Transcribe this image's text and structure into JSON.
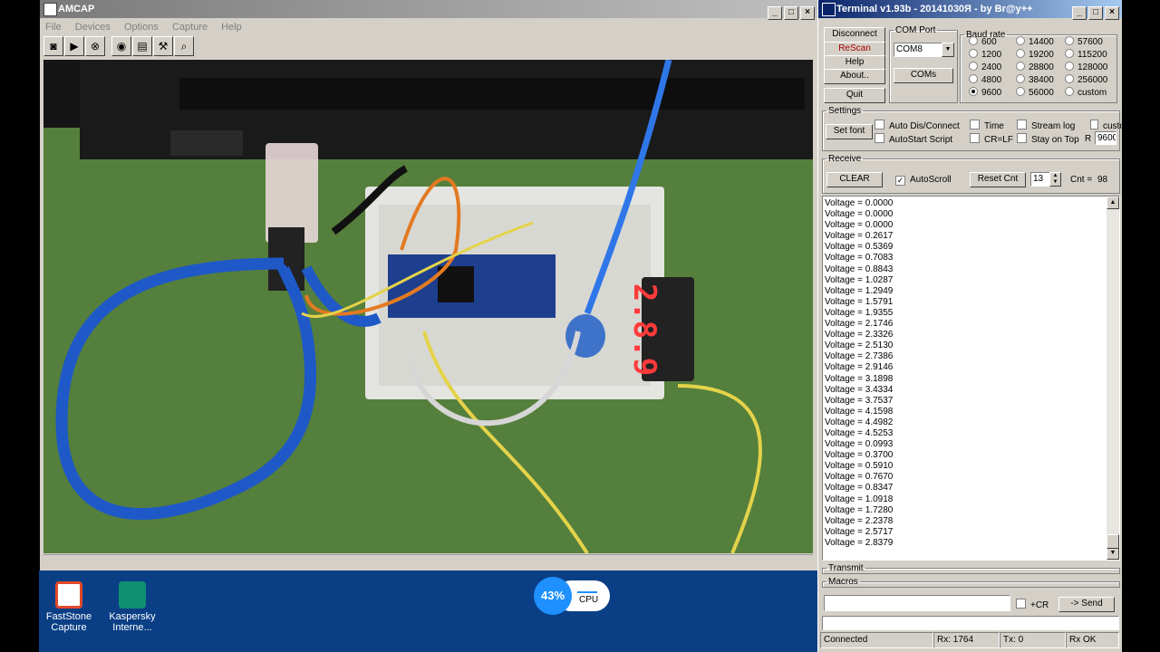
{
  "amcap": {
    "title": "AMCAP",
    "menu": [
      "File",
      "Devices",
      "Options",
      "Capture",
      "Help"
    ],
    "toolbar_icons": [
      "camera-icon",
      "play-icon",
      "stop-icon",
      "preview-icon",
      "properties-icon",
      "tools-icon",
      "zoom-icon"
    ]
  },
  "desktop": {
    "icons": [
      {
        "label_line1": "FastStone",
        "label_line2": "Capture",
        "color": "#e24a2b"
      },
      {
        "label_line1": "Kaspersky",
        "label_line2": "Interne...",
        "color": "#0f8f6f"
      }
    ],
    "cpu": {
      "percent": "43%",
      "label": "CPU"
    }
  },
  "display": {
    "digits": "2.8.9"
  },
  "terminal": {
    "title": "Terminal v1.93b - 20141030Я - by Br@y++",
    "buttons": {
      "disconnect": "Disconnect",
      "rescan": "ReScan",
      "help": "Help",
      "about": "About..",
      "quit": "Quit"
    },
    "com_port": {
      "legend": "COM Port",
      "selected": "COM8",
      "coms_button": "COMs"
    },
    "baud": {
      "legend": "Baud rate",
      "options": [
        "600",
        "1200",
        "2400",
        "4800",
        "9600",
        "14400",
        "19200",
        "28800",
        "38400",
        "56000",
        "57600",
        "115200",
        "128000",
        "256000",
        "custom"
      ],
      "selected": "9600"
    },
    "settings": {
      "legend": "Settings",
      "set_font": "Set font",
      "auto_dis_connect": "Auto Dis/Connect",
      "autostart_script": "AutoStart Script",
      "time": "Time",
      "cr_lf": "CR=LF",
      "stream_log": "Stream log",
      "stay_on_top": "Stay on Top",
      "custom_label": "custo",
      "r_label": "R",
      "custom_value": "9600"
    },
    "receive": {
      "legend": "Receive",
      "clear": "CLEAR",
      "autoscroll": "AutoScroll",
      "reset_cnt": "Reset Cnt",
      "cnt_value": "13",
      "cnt_label": "Cnt =",
      "cnt_count": "98"
    },
    "log": [
      "Voltage = 0.0000",
      "Voltage = 0.0000",
      "Voltage = 0.0000",
      "Voltage = 0.2617",
      "Voltage = 0.5369",
      "Voltage = 0.7083",
      "Voltage = 0.8843",
      "Voltage = 1.0287",
      "Voltage = 1.2949",
      "Voltage = 1.5791",
      "Voltage = 1.9355",
      "Voltage = 2.1746",
      "Voltage = 2.3326",
      "Voltage = 2.5130",
      "Voltage = 2.7386",
      "Voltage = 2.9146",
      "Voltage = 3.1898",
      "Voltage = 3.4334",
      "Voltage = 3.7537",
      "Voltage = 4.1598",
      "Voltage = 4.4982",
      "Voltage = 4.5253",
      "Voltage = 0.0993",
      "Voltage = 0.3700",
      "Voltage = 0.5910",
      "Voltage = 0.7670",
      "Voltage = 0.8347",
      "Voltage = 1.0918",
      "Voltage = 1.7280",
      "Voltage = 2.2378",
      "Voltage = 2.5717",
      "Voltage = 2.8379"
    ],
    "transmit_legend": "Transmit",
    "macros_legend": "Macros",
    "send": {
      "input_value": "",
      "cr_label": "+CR",
      "send_button": "-> Send"
    },
    "status": {
      "state": "Connected",
      "rx": "Rx: 1764",
      "tx": "Tx: 0",
      "rx_ok": "Rx OK"
    }
  }
}
